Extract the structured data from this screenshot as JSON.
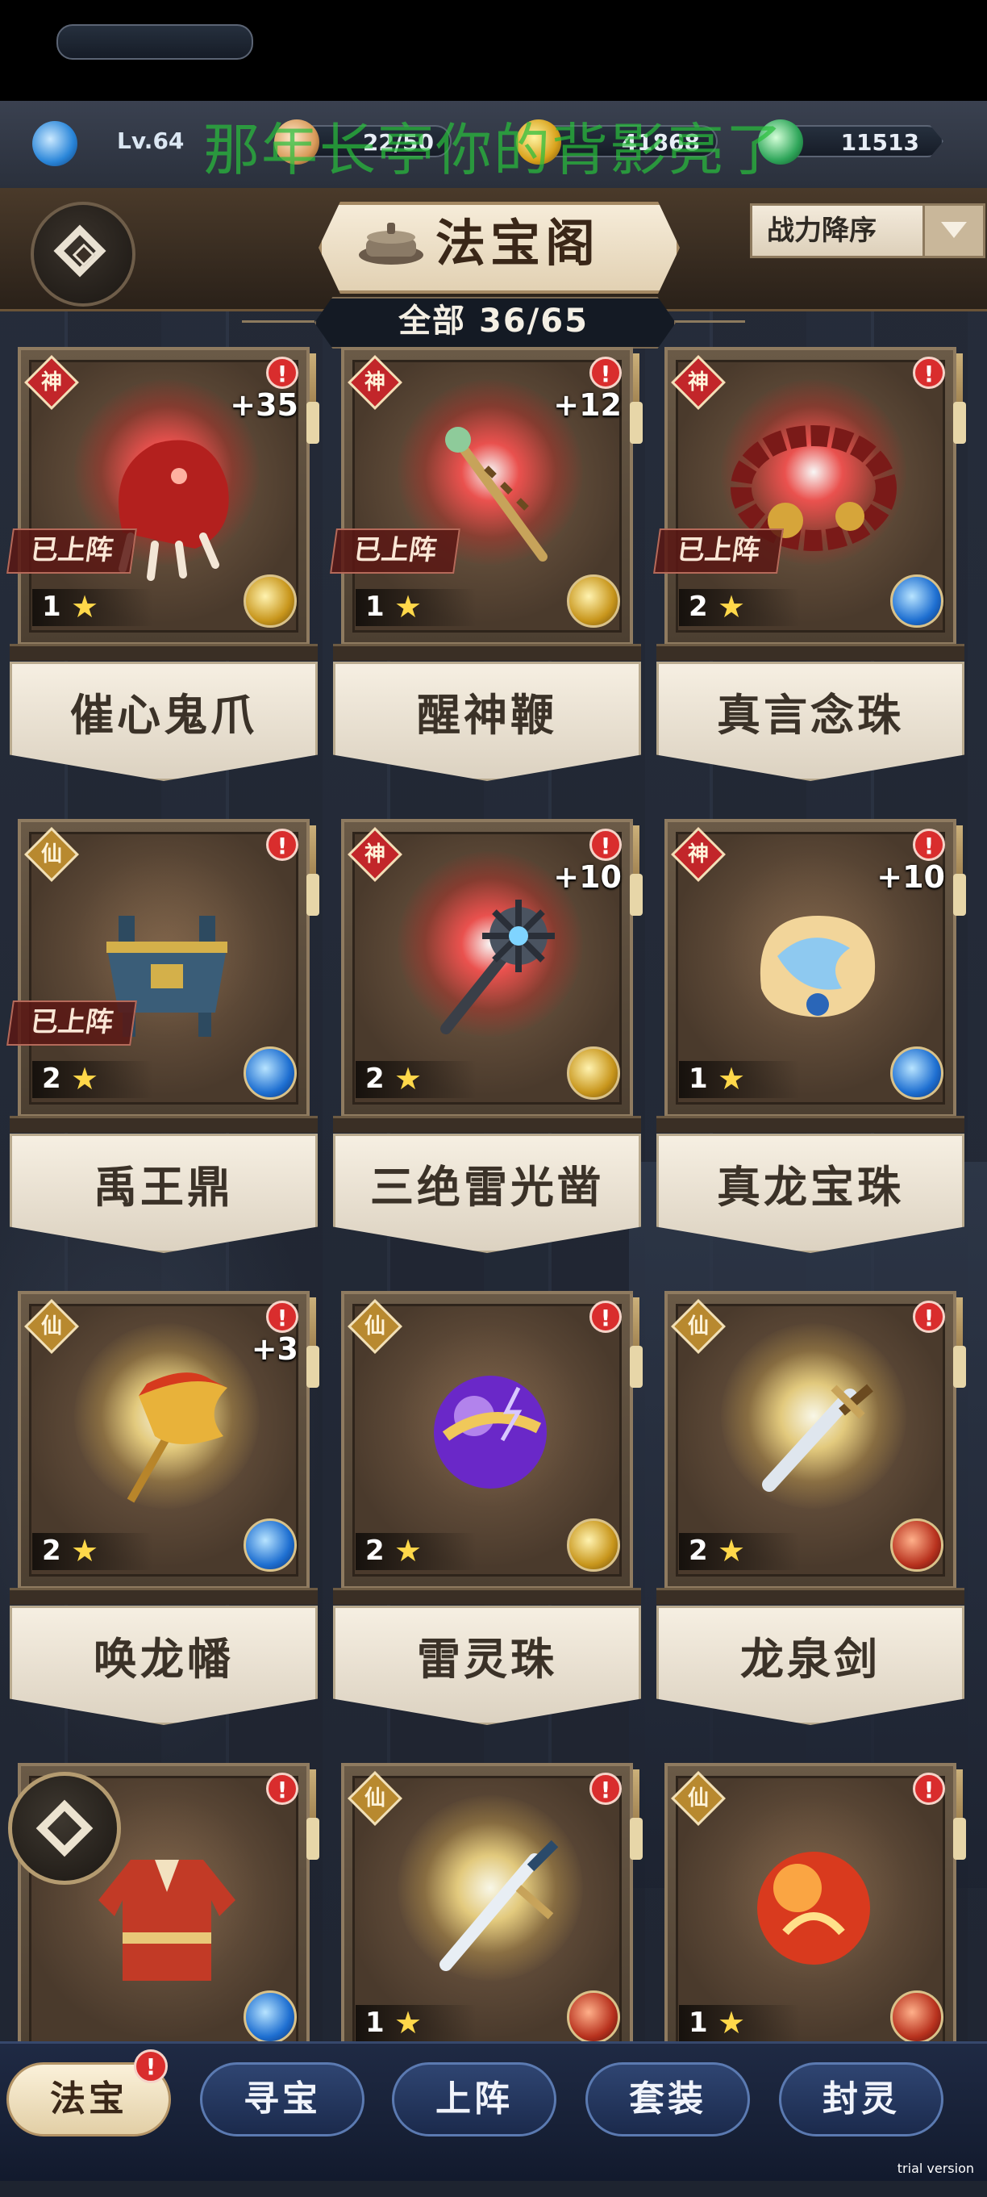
{
  "overlay_title": "那年长亭你的背影亮了",
  "resources": {
    "level": "Lv.64",
    "stamina": "22/50",
    "gold": "41868",
    "jade": "11513"
  },
  "header": {
    "title": "法宝阁",
    "sort_label": "战力降序",
    "count_text": "全部 36/65"
  },
  "cards": [
    {
      "name": "催心鬼爪",
      "tier": "神",
      "plus": "+35",
      "on_stage": "已上阵",
      "stars": "1",
      "element": "gold",
      "glow": "red",
      "icon": "claw-icon"
    },
    {
      "name": "醒神鞭",
      "tier": "神",
      "plus": "+12",
      "on_stage": "已上阵",
      "stars": "1",
      "element": "gold",
      "glow": "red",
      "icon": "whip-icon"
    },
    {
      "name": "真言念珠",
      "tier": "神",
      "plus": "",
      "on_stage": "已上阵",
      "stars": "2",
      "element": "blue",
      "glow": "red",
      "icon": "prayer-beads-icon"
    },
    {
      "name": "禹王鼎",
      "tier": "仙",
      "plus": "",
      "on_stage": "已上阵",
      "stars": "2",
      "element": "blue",
      "glow": "none",
      "icon": "cauldron-icon"
    },
    {
      "name": "三绝雷光凿",
      "tier": "神",
      "plus": "+10",
      "on_stage": "",
      "stars": "2",
      "element": "gold",
      "glow": "red",
      "icon": "mace-icon"
    },
    {
      "name": "真龙宝珠",
      "tier": "神",
      "plus": "+10",
      "on_stage": "",
      "stars": "1",
      "element": "blue",
      "glow": "none",
      "icon": "dragon-pearl-icon"
    },
    {
      "name": "唤龙幡",
      "tier": "仙",
      "plus": "+3",
      "on_stage": "",
      "stars": "2",
      "element": "blue",
      "glow": "gold",
      "icon": "banner-icon"
    },
    {
      "name": "雷灵珠",
      "tier": "仙",
      "plus": "",
      "on_stage": "",
      "stars": "2",
      "element": "gold",
      "glow": "none",
      "icon": "thunder-orb-icon"
    },
    {
      "name": "龙泉剑",
      "tier": "仙",
      "plus": "",
      "on_stage": "",
      "stars": "2",
      "element": "red",
      "glow": "gold",
      "icon": "sword-icon"
    },
    {
      "name": "",
      "tier": "",
      "plus": "",
      "on_stage": "",
      "stars": "",
      "element": "blue",
      "glow": "none",
      "icon": "robe-icon"
    },
    {
      "name": "",
      "tier": "仙",
      "plus": "",
      "on_stage": "",
      "stars": "1",
      "element": "red",
      "glow": "gold",
      "icon": "long-sword-icon"
    },
    {
      "name": "",
      "tier": "仙",
      "plus": "",
      "on_stage": "",
      "stars": "1",
      "element": "red",
      "glow": "none",
      "icon": "fire-orb-icon"
    }
  ],
  "alert_mark": "!",
  "star_glyph": "★",
  "tabs": [
    "法宝",
    "寻宝",
    "上阵",
    "套装",
    "封灵"
  ],
  "active_tab": "法宝",
  "watermark": "trial version",
  "colors": {
    "tier_shen": "#c2262a",
    "tier_xian": "#b8892f",
    "star": "#ffd84a",
    "alert": "#d92d2d"
  }
}
